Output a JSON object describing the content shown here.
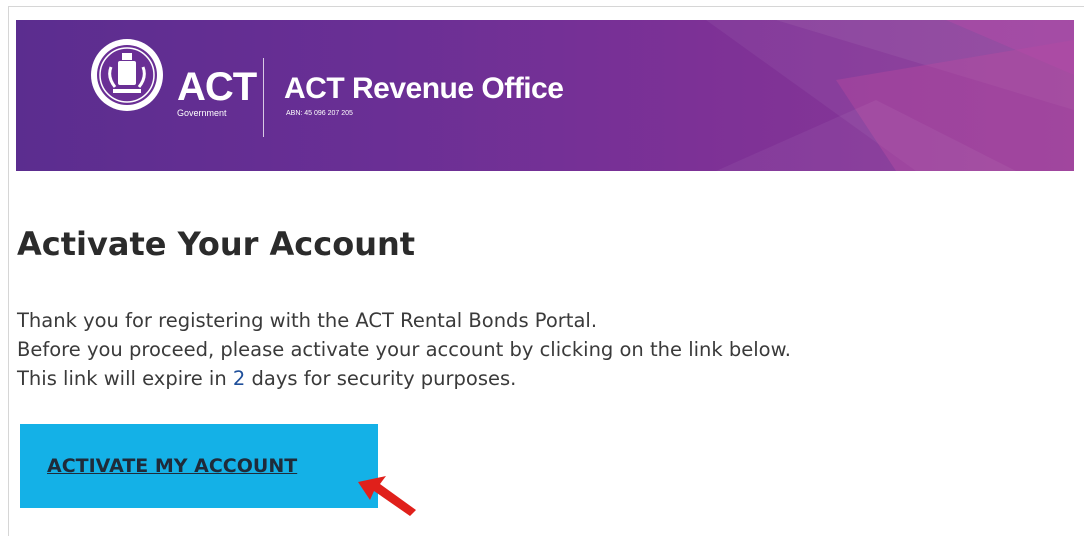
{
  "banner": {
    "logo_text": "ACT",
    "logo_subtext": "Government",
    "office_title": "ACT Revenue Office",
    "abn": "ABN: 45 096 207 205"
  },
  "content": {
    "heading": "Activate Your Account",
    "line1": "Thank you for registering with the ACT Rental Bonds Portal.",
    "line2": "Before you proceed, please activate your account by clicking on the link below.",
    "line3_prefix": "This link will expire in ",
    "line3_days": "2",
    "line3_suffix": " days for security purposes."
  },
  "button": {
    "label": "ACTIVATE MY ACCOUNT"
  },
  "colors": {
    "banner_start": "#5b2d8f",
    "banner_end": "#8c3a98",
    "button_bg": "#14b1e7",
    "arrow": "#e0201b"
  }
}
